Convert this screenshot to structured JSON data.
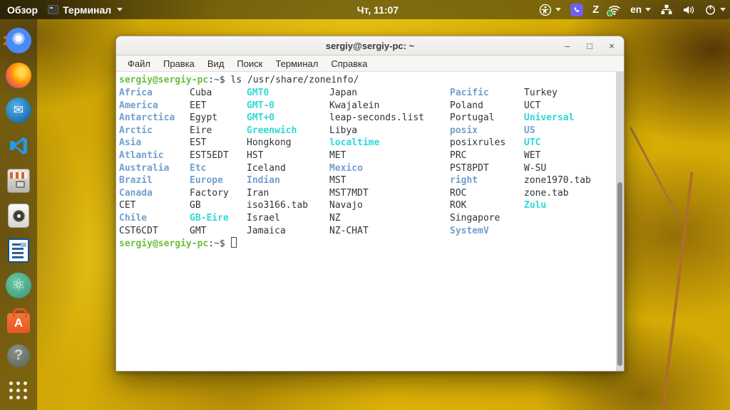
{
  "top_bar": {
    "activities_label": "Обзор",
    "app_menu_label": "Терминал",
    "clock": "Чт, 11:07",
    "language": "en",
    "tray_items": [
      "accessibility",
      "viber",
      "z-app",
      "wifi-vpn",
      "language",
      "wired-network",
      "volume",
      "power"
    ]
  },
  "dock": {
    "items": [
      {
        "name": "chromium",
        "indicators": 2
      },
      {
        "name": "firefox",
        "indicators": 0
      },
      {
        "name": "thunderbird",
        "indicators": 0
      },
      {
        "name": "vscode",
        "indicators": 0
      },
      {
        "name": "file-cabinet",
        "indicators": 0
      },
      {
        "name": "speaker-app",
        "indicators": 0
      },
      {
        "name": "libreoffice-writer",
        "indicators": 0
      },
      {
        "name": "atom",
        "indicators": 0
      },
      {
        "name": "ubuntu-software",
        "indicators": 0
      },
      {
        "name": "help",
        "indicators": 0
      },
      {
        "name": "app-grid",
        "indicators": 0
      }
    ],
    "thunderbird_glyph": "✉",
    "atom_glyph": "⚛",
    "software_glyph": "A",
    "help_glyph": "?"
  },
  "window": {
    "title": "sergiy@sergiy-pc: ~",
    "controls": {
      "minimize": "–",
      "maximize": "□",
      "close": "×"
    },
    "menu_items": [
      "Файл",
      "Правка",
      "Вид",
      "Поиск",
      "Терминал",
      "Справка"
    ]
  },
  "terminal": {
    "prompt": {
      "user": "sergiy@sergiy-pc",
      "sep": ":",
      "path": "~",
      "symbol": "$"
    },
    "command": " ls /usr/share/zoneinfo/",
    "listing": [
      [
        [
          "Africa",
          "d"
        ],
        [
          "Cuba",
          "f"
        ],
        [
          "GMT0",
          "l"
        ],
        [
          "Japan",
          "f"
        ],
        [
          "Pacific",
          "d"
        ],
        [
          "Turkey",
          "f"
        ]
      ],
      [
        [
          "America",
          "d"
        ],
        [
          "EET",
          "f"
        ],
        [
          "GMT-0",
          "l"
        ],
        [
          "Kwajalein",
          "f"
        ],
        [
          "Poland",
          "f"
        ],
        [
          "UCT",
          "f"
        ]
      ],
      [
        [
          "Antarctica",
          "d"
        ],
        [
          "Egypt",
          "f"
        ],
        [
          "GMT+0",
          "l"
        ],
        [
          "leap-seconds.list",
          "f"
        ],
        [
          "Portugal",
          "f"
        ],
        [
          "Universal",
          "l"
        ]
      ],
      [
        [
          "Arctic",
          "d"
        ],
        [
          "Eire",
          "f"
        ],
        [
          "Greenwich",
          "l"
        ],
        [
          "Libya",
          "f"
        ],
        [
          "posix",
          "d"
        ],
        [
          "US",
          "d"
        ]
      ],
      [
        [
          "Asia",
          "d"
        ],
        [
          "EST",
          "f"
        ],
        [
          "Hongkong",
          "f"
        ],
        [
          "localtime",
          "l"
        ],
        [
          "posixrules",
          "f"
        ],
        [
          "UTC",
          "l"
        ]
      ],
      [
        [
          "Atlantic",
          "d"
        ],
        [
          "EST5EDT",
          "f"
        ],
        [
          "HST",
          "f"
        ],
        [
          "MET",
          "f"
        ],
        [
          "PRC",
          "f"
        ],
        [
          "WET",
          "f"
        ]
      ],
      [
        [
          "Australia",
          "d"
        ],
        [
          "Etc",
          "d"
        ],
        [
          "Iceland",
          "f"
        ],
        [
          "Mexico",
          "d"
        ],
        [
          "PST8PDT",
          "f"
        ],
        [
          "W-SU",
          "f"
        ]
      ],
      [
        [
          "Brazil",
          "d"
        ],
        [
          "Europe",
          "d"
        ],
        [
          "Indian",
          "d"
        ],
        [
          "MST",
          "f"
        ],
        [
          "right",
          "d"
        ],
        [
          "zone1970.tab",
          "f"
        ]
      ],
      [
        [
          "Canada",
          "d"
        ],
        [
          "Factory",
          "f"
        ],
        [
          "Iran",
          "f"
        ],
        [
          "MST7MDT",
          "f"
        ],
        [
          "ROC",
          "f"
        ],
        [
          "zone.tab",
          "f"
        ]
      ],
      [
        [
          "CET",
          "f"
        ],
        [
          "GB",
          "f"
        ],
        [
          "iso3166.tab",
          "f"
        ],
        [
          "Navajo",
          "f"
        ],
        [
          "ROK",
          "f"
        ],
        [
          "Zulu",
          "l"
        ]
      ],
      [
        [
          "Chile",
          "d"
        ],
        [
          "GB-Eire",
          "l"
        ],
        [
          "Israel",
          "f"
        ],
        [
          "NZ",
          "f"
        ],
        [
          "Singapore",
          "f"
        ]
      ],
      [
        [
          "CST6CDT",
          "f"
        ],
        [
          "GMT",
          "f"
        ],
        [
          "Jamaica",
          "f"
        ],
        [
          "NZ-CHAT",
          "f"
        ],
        [
          "SystemV",
          "d"
        ]
      ]
    ]
  },
  "colors": {
    "prompt_green": "#6abe3e",
    "dir_blue": "#729fcf",
    "link_cyan": "#2fd8d8",
    "tilde_blue": "#4e7fbf",
    "text": "#2e3436",
    "viber_purple": "#7360f2",
    "software_orange": "#e95420"
  }
}
